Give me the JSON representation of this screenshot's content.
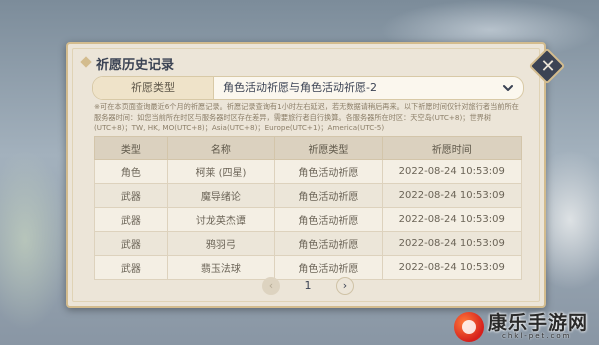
{
  "dialog": {
    "title": "祈愿历史记录",
    "filter": {
      "label": "祈愿类型",
      "value": "角色活动祈愿与角色活动祈愿-2"
    },
    "notice": "※可在本页面查询最近6个月的祈愿记录。祈愿记录查询有1小时左右延迟，若无数据请稍后再来。以下祈愿时间仅针对旅行者当前所在服务器时间：如您当前所在时区与服务器时区存在差异，需要旅行者自行换算。各服务器所在时区：天空岛(UTC+8)；世界树(UTC+8)；TW, HK, MO(UTC+8)；Asia(UTC+8)；Europe(UTC+1)；America(UTC-5)",
    "table": {
      "headers": [
        "类型",
        "名称",
        "祈愿类型",
        "祈愿时间"
      ],
      "rows": [
        {
          "type": "角色",
          "name": "柯莱 (四星)",
          "gacha_type": "角色活动祈愿",
          "time": "2022-08-24 10:53:09"
        },
        {
          "type": "武器",
          "name": "魔导绪论",
          "gacha_type": "角色活动祈愿",
          "time": "2022-08-24 10:53:09"
        },
        {
          "type": "武器",
          "name": "讨龙英杰谭",
          "gacha_type": "角色活动祈愿",
          "time": "2022-08-24 10:53:09"
        },
        {
          "type": "武器",
          "name": "鸦羽弓",
          "gacha_type": "角色活动祈愿",
          "time": "2022-08-24 10:53:09"
        },
        {
          "type": "武器",
          "name": "翡玉法球",
          "gacha_type": "角色活动祈愿",
          "time": "2022-08-24 10:53:09"
        }
      ]
    },
    "pager": {
      "prev": "‹",
      "page": "1",
      "next": "›"
    },
    "close_glyph": "✕"
  },
  "watermark": {
    "text": "康乐手游网",
    "sub": "chkl-pet.com"
  },
  "colors": {
    "panel_bg": "#ece5d8",
    "panel_border": "#d3bc8e",
    "four_star_name": "#a256e1",
    "title_text": "#3b4354"
  }
}
